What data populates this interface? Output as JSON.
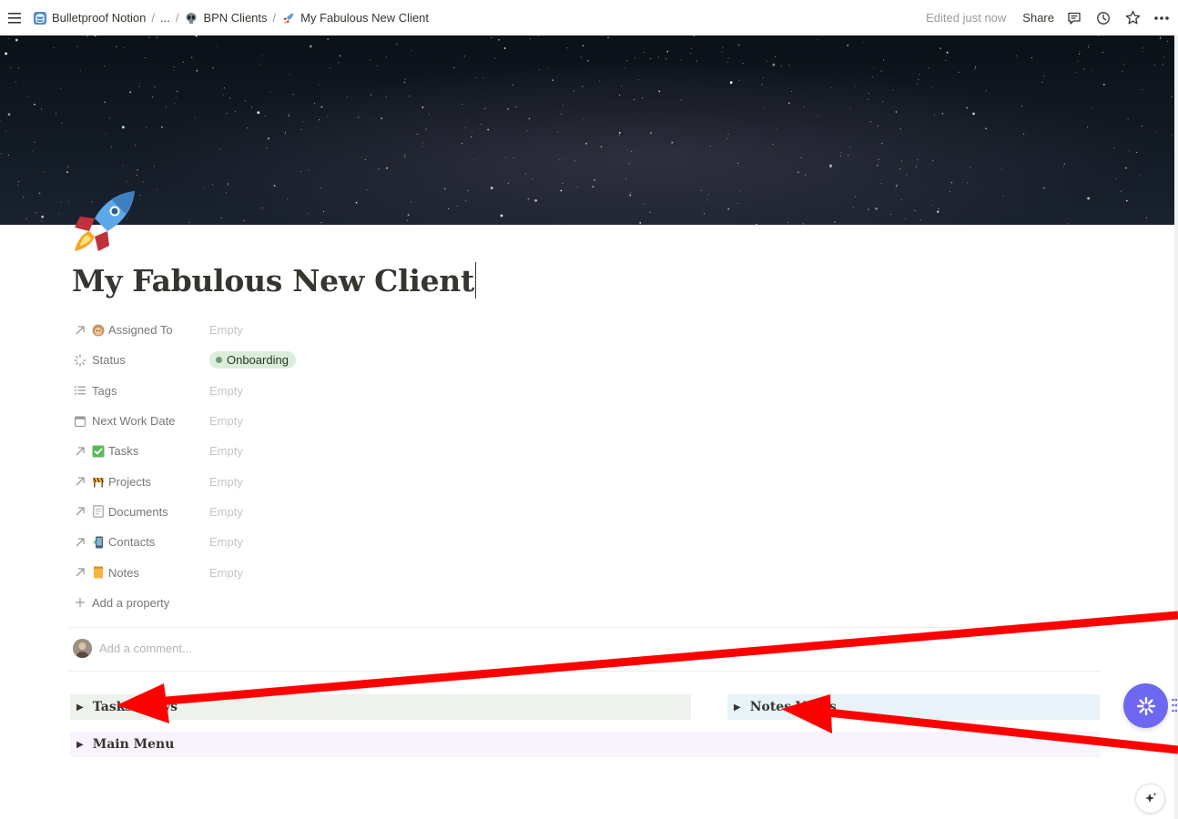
{
  "breadcrumb": {
    "workspace": "Bulletproof Notion",
    "ellipsis": "...",
    "database": "BPN Clients",
    "page": "My Fabulous New Client",
    "separator": "/"
  },
  "topbar": {
    "edited": "Edited just now",
    "share": "Share"
  },
  "page": {
    "title": "My Fabulous New Client",
    "icon": "rocket-icon"
  },
  "properties": [
    {
      "name": "Assigned To",
      "value": "Empty",
      "icon": "relation-arrow-icon",
      "emoji": "person-face-icon"
    },
    {
      "name": "Status",
      "value": "Onboarding",
      "icon": "status-spinner-icon"
    },
    {
      "name": "Tags",
      "value": "Empty",
      "icon": "list-icon"
    },
    {
      "name": "Next Work Date",
      "value": "Empty",
      "icon": "calendar-icon"
    },
    {
      "name": "Tasks",
      "value": "Empty",
      "icon": "relation-arrow-icon",
      "emoji": "check-box-icon"
    },
    {
      "name": "Projects",
      "value": "Empty",
      "icon": "relation-arrow-icon",
      "emoji": "construction-icon"
    },
    {
      "name": "Documents",
      "value": "Empty",
      "icon": "relation-arrow-icon",
      "emoji": "document-icon"
    },
    {
      "name": "Contacts",
      "value": "Empty",
      "icon": "relation-arrow-icon",
      "emoji": "phone-icon"
    },
    {
      "name": "Notes",
      "value": "Empty",
      "icon": "relation-arrow-icon",
      "emoji": "notepad-icon"
    }
  ],
  "add_property": "Add a property",
  "comment": {
    "placeholder": "Add a comment..."
  },
  "toggles": {
    "tasks": "Tasks Views",
    "notes": "Notes Views",
    "main_menu": "Main Menu"
  },
  "colors": {
    "status_bg": "#dbeddb",
    "status_dot": "#6c9b7d",
    "toggle_green": "#edf3ec",
    "toggle_blue": "#e7f3f8",
    "toggle_purple": "#f8f3fc",
    "fab": "#6d67f2",
    "annotation": "#ff0000"
  }
}
